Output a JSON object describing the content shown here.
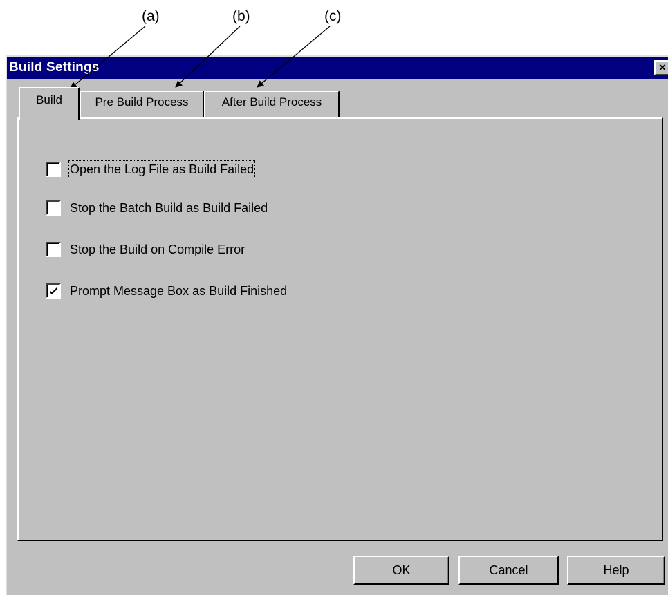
{
  "annotations": {
    "a": "(a)",
    "b": "(b)",
    "c": "(c)"
  },
  "dialog": {
    "title": "Build Settings",
    "close_glyph": "×"
  },
  "tabs": [
    {
      "label": "Build",
      "active": true
    },
    {
      "label": "Pre Build Process",
      "active": false
    },
    {
      "label": "After Build Process",
      "active": false
    }
  ],
  "options": [
    {
      "label": "Open the Log File as Build Failed",
      "checked": false
    },
    {
      "label": "Stop the Batch Build as Build Failed",
      "checked": false
    },
    {
      "label": "Stop the Build on Compile Error",
      "checked": false
    },
    {
      "label": "Prompt Message Box as Build Finished",
      "checked": true
    }
  ],
  "buttons": {
    "ok": "OK",
    "cancel": "Cancel",
    "help": "Help"
  },
  "colors": {
    "titlebar": "#000080",
    "face": "#c0c0c0"
  }
}
